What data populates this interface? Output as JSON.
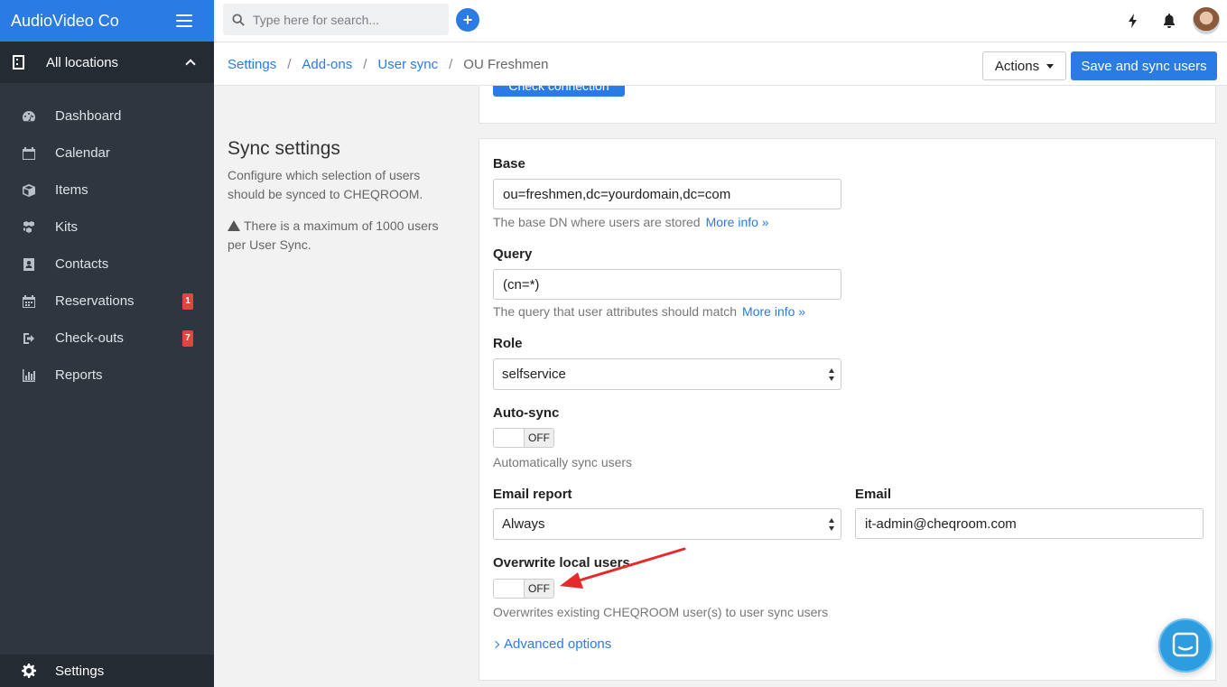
{
  "brand": {
    "name": "AudioVideo Co"
  },
  "locations": {
    "label": "All locations"
  },
  "nav": {
    "items": [
      {
        "label": "Dashboard",
        "icon": "dashboard-icon"
      },
      {
        "label": "Calendar",
        "icon": "calendar-icon"
      },
      {
        "label": "Items",
        "icon": "box-icon"
      },
      {
        "label": "Kits",
        "icon": "kits-icon"
      },
      {
        "label": "Contacts",
        "icon": "contacts-icon"
      },
      {
        "label": "Reservations",
        "icon": "reservations-icon",
        "badge": "1"
      },
      {
        "label": "Check-outs",
        "icon": "checkout-icon",
        "badge": "7"
      },
      {
        "label": "Reports",
        "icon": "bar-chart-icon"
      }
    ],
    "settings": "Settings"
  },
  "search": {
    "placeholder": "Type here for search..."
  },
  "topbar": {
    "add_label": "+"
  },
  "breadcrumb": {
    "items": [
      "Settings",
      "Add-ons",
      "User sync"
    ],
    "current": "OU Freshmen",
    "separator": "/"
  },
  "header": {
    "actions_label": "Actions",
    "save_label": "Save and sync users"
  },
  "prev_section": {
    "button_label": "Check connection"
  },
  "section": {
    "title": "Sync settings",
    "description": "Configure which selection of users should be synced to CHEQROOM.",
    "warning": "There is a maximum of 1000 users per User Sync."
  },
  "form": {
    "base": {
      "label": "Base",
      "value": "ou=freshmen,dc=yourdomain,dc=com",
      "help": "The base DN where users are stored",
      "more": "More info »"
    },
    "query": {
      "label": "Query",
      "value": "(cn=*)",
      "help": "The query that user attributes should match",
      "more": "More info »"
    },
    "role": {
      "label": "Role",
      "value": "selfservice"
    },
    "autosync": {
      "label": "Auto-sync",
      "state": "OFF",
      "help": "Automatically sync users"
    },
    "email_report": {
      "label": "Email report",
      "value": "Always"
    },
    "email": {
      "label": "Email",
      "value": "it-admin@cheqroom.com"
    },
    "overwrite": {
      "label": "Overwrite local users",
      "state": "OFF",
      "help": "Overwrites existing CHEQROOM user(s) to user sync users"
    },
    "advanced": "Advanced options"
  },
  "colors": {
    "accent": "#2a7be4",
    "sidebar": "#2f3640",
    "badge": "#e0463f",
    "annotation_arrow": "#e32b2b"
  }
}
